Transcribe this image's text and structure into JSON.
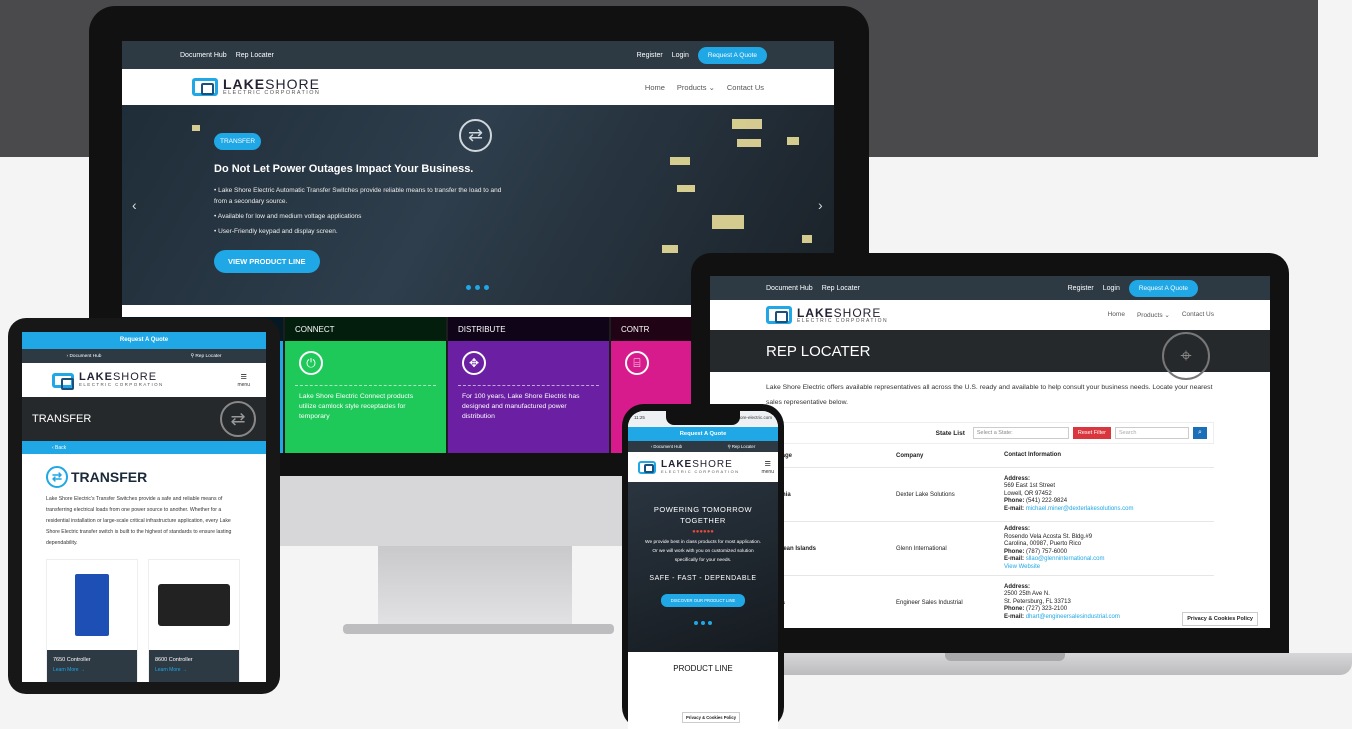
{
  "brand": {
    "name_bold": "LAKE",
    "name_light": "SHORE",
    "subtitle": "ELECTRIC CORPORATION"
  },
  "desktop": {
    "topbar": {
      "document_hub": "Document Hub",
      "rep_locater": "Rep Locater",
      "register": "Register",
      "login": "Login",
      "quote": "Request A Quote"
    },
    "nav": {
      "home": "Home",
      "products": "Products ⌄",
      "contact": "Contact Us"
    },
    "hero": {
      "badge": "TRANSFER",
      "title": "Do Not Let Power Outages Impact Your Business.",
      "bullets": [
        "Lake Shore Electric Automatic Transfer Switches provide reliable means to transfer the load to and from a secondary source.",
        "Available for low and medium voltage applications",
        "User-Friendly keypad and display screen."
      ],
      "cta": "VIEW PRODUCT LINE"
    },
    "tiles": [
      {
        "head": "",
        "text": "",
        "color": "#1fa7e6"
      },
      {
        "head": "CONNECT",
        "text": "Lake Shore Electric Connect products utilize camlock style receptacles for temporary",
        "color": "#1ec95a"
      },
      {
        "head": "DISTRIBUTE",
        "text": "For 100 years, Lake Shore Electric has designed and manufactured power distribution",
        "color": "#6b1fa3"
      },
      {
        "head": "CONTR",
        "text": "",
        "color": "#d81b8c"
      }
    ]
  },
  "laptop": {
    "topbar": {
      "document_hub": "Document Hub",
      "rep_locater": "Rep Locater",
      "register": "Register",
      "login": "Login",
      "quote": "Request A Quote"
    },
    "nav": {
      "home": "Home",
      "products": "Products ⌄",
      "contact": "Contact Us"
    },
    "banner": "REP LOCATER",
    "intro": "Lake Shore Electric offers available representatives all across the U.S. ready and available to help consult your business needs. Locate your nearest sales representative below.",
    "filter": {
      "label": "State List",
      "select_placeholder": "Select a State:",
      "reset": "Reset Filter",
      "search_placeholder": "Search"
    },
    "table": {
      "headers": [
        "erage",
        "Company",
        "Contact Information"
      ],
      "rows": [
        {
          "coverage": "ornia",
          "company": "Dexter Lake Solutions",
          "addr_label": "Address:",
          "addr1": "569 East 1st Street",
          "addr2": "Lowell, OR 97452",
          "phone_label": "Phone:",
          "phone": "(541) 222-9824",
          "email_label": "E-mail:",
          "email": "michael.miner@dexterlakesolutions.com",
          "extra": ""
        },
        {
          "coverage": "bbean Islands",
          "company": "Glenn International",
          "addr_label": "Address:",
          "addr1": "Rosendo Vela Acosta St. Bldg.#9",
          "addr2": "Carolina, 00987, Puerto Rico",
          "phone_label": "Phone:",
          "phone": "(787) 757-6000",
          "email_label": "E-mail:",
          "email": "sllao@glenninternational.com",
          "extra": "View Website"
        },
        {
          "coverage": "ida",
          "company": "Engineer Sales Industrial",
          "addr_label": "Address:",
          "addr1": "2500 25th Ave N.",
          "addr2": "St. Petersburg, FL 33713",
          "phone_label": "Phone:",
          "phone": "(727) 323-2100",
          "email_label": "E-mail:",
          "email": "dhart@engineersalesindustrial.com",
          "extra": ""
        }
      ]
    },
    "privacy": "Privacy & Cookies Policy"
  },
  "tablet": {
    "quote": "Request A Quote",
    "document_hub": "Document Hub",
    "rep_locater": "Rep Locater",
    "menu": "menu",
    "banner": "TRANSFER",
    "back": "‹ Back",
    "title": "TRANSFER",
    "desc": "Lake Shore Electric's Transfer Switches provide a safe and reliable means of transferring electrical loads from one power source to another. Whether for a residential installation or large-scale critical infrastructure application, every Lake Shore Electric transfer switch is built to the highest of standards to ensure lasting dependability.",
    "products": [
      {
        "name": "7650 Controller",
        "more": "Learn More →"
      },
      {
        "name": "8600 Controller",
        "more": "Learn More →"
      }
    ]
  },
  "phone": {
    "time": "11:25",
    "url": "lake-shore-electric.com",
    "quote": "Request A Quote",
    "document_hub": "Document Hub",
    "rep_locater": "Rep Locater",
    "menu": "menu",
    "hero_title_1": "POWERING TOMORROW",
    "hero_title_2": "TOGETHER",
    "stars": "●●●●●●",
    "p1": "We provide best in class products for most application.",
    "p2": "Or we will work with you on customized solution specifically for your needs.",
    "safe": "SAFE - FAST - DEPENDABLE",
    "cta": "DISCOVER OUR PRODUCT LINE",
    "product_line": "PRODUCT LINE",
    "privacy": "Privacy & Cookies Policy"
  }
}
